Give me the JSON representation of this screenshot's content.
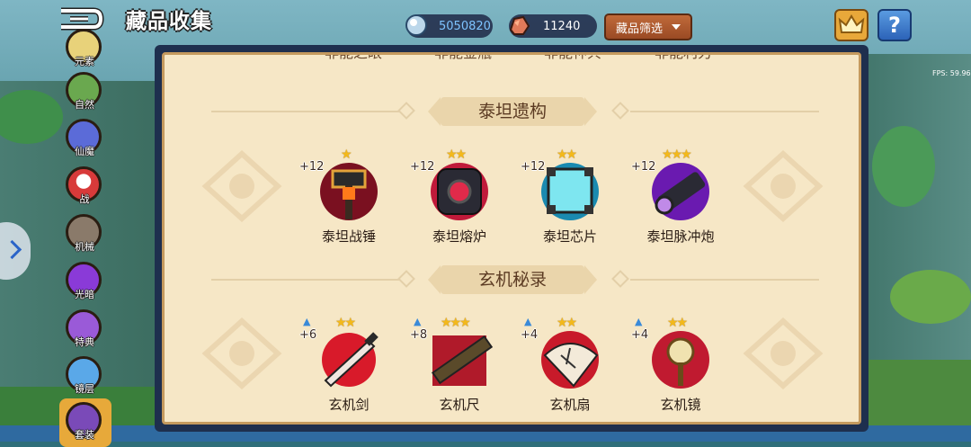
{
  "header": {
    "title": "藏品收集",
    "resources": [
      {
        "icon": "crystal-icon",
        "value": "5050820",
        "color": "#7ec3ff"
      },
      {
        "icon": "ore-icon",
        "value": "11240",
        "color": "#ffffff"
      }
    ],
    "filter_label": "藏品筛选",
    "help_label": "?"
  },
  "fps": "FPS: 59.96",
  "sidebar": {
    "items": [
      {
        "label": "元素",
        "icon": "element-icon",
        "color": "#e8d27a"
      },
      {
        "label": "自然",
        "icon": "nature-icon",
        "color": "#6aa84f"
      },
      {
        "label": "仙魔",
        "icon": "fairy-demon-icon",
        "color": "#5b6bd8"
      },
      {
        "label": "战",
        "icon": "battle-icon",
        "color": "#d83a3a"
      },
      {
        "label": "机械",
        "icon": "mech-icon",
        "color": "#8a7a6a"
      },
      {
        "label": "光暗",
        "icon": "light-dark-icon",
        "color": "#8a3ad8"
      },
      {
        "label": "特典",
        "icon": "special-icon",
        "color": "#9a5ad8"
      },
      {
        "label": "镜层",
        "icon": "mirror-icon",
        "color": "#5aa8e8"
      },
      {
        "label": "套装",
        "icon": "set-icon",
        "color": "#7a4ab8"
      }
    ]
  },
  "collections": [
    {
      "title": "泰坦遗构",
      "items": [
        {
          "name": "泰坦战锤",
          "plus": "+12",
          "stars": "★",
          "icon": "titan-hammer-icon",
          "color": "#e3a33a"
        },
        {
          "name": "泰坦熔炉",
          "plus": "+12",
          "stars": "★★",
          "icon": "titan-furnace-icon",
          "color": "#d8304a"
        },
        {
          "name": "泰坦芯片",
          "plus": "+12",
          "stars": "★★",
          "icon": "titan-chip-icon",
          "color": "#4ad8e0"
        },
        {
          "name": "泰坦脉冲炮",
          "plus": "+12",
          "stars": "★★★",
          "icon": "titan-pulse-cannon-icon",
          "color": "#8a3ae0"
        }
      ]
    },
    {
      "title": "玄机秘录",
      "items": [
        {
          "name": "玄机剑",
          "plus": "+6",
          "stars": "★★",
          "icon": "xuanji-sword-icon",
          "color": "#d81a2a"
        },
        {
          "name": "玄机尺",
          "plus": "+8",
          "stars": "★★★",
          "icon": "xuanji-ruler-icon",
          "color": "#c8202a"
        },
        {
          "name": "玄机扇",
          "plus": "+4",
          "stars": "★★",
          "icon": "xuanji-fan-icon",
          "color": "#d82a2a"
        },
        {
          "name": "玄机镜",
          "plus": "+4",
          "stars": "★★",
          "icon": "xuanji-mirror-icon",
          "color": "#c82a3a"
        }
      ]
    }
  ],
  "cut_off_labels": [
    "非能之眼",
    "非能金瓶",
    "非能神兵",
    "非能利刃"
  ]
}
